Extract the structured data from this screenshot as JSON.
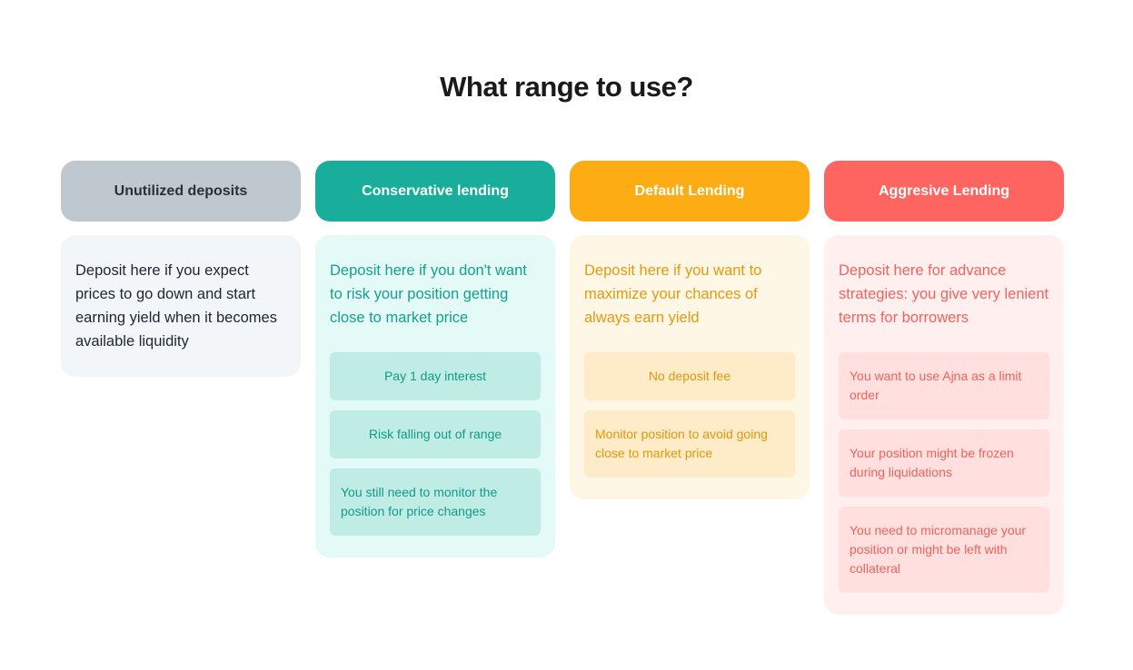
{
  "title": "What range to use?",
  "columns": [
    {
      "header": "Unutilized deposits",
      "description": "Deposit here if you expect prices to go down and start earning yield when it becomes available liquidity",
      "items": [],
      "colors": {
        "header_bg": "#bfc8cf",
        "body_bg": "#f2f6f9",
        "text": "#1d2630"
      }
    },
    {
      "header": "Conservative lending",
      "description": "Deposit here if you don't want to risk your position getting close to market price",
      "items": [
        "Pay 1 day interest",
        "Risk falling out of range",
        "You still need to monitor the position for price changes"
      ],
      "colors": {
        "header_bg": "#19ae9b",
        "body_bg": "#e4faf6",
        "text": "#14a08e"
      }
    },
    {
      "header": "Default Lending",
      "description": "Deposit here if you want to maximize your chances of always earn yield",
      "items": [
        "No deposit fee",
        "Monitor position to avoid going close to market price"
      ],
      "colors": {
        "header_bg": "#fdac13",
        "body_bg": "#fff7e5",
        "text": "#e39a10"
      }
    },
    {
      "header": "Aggresive Lending",
      "description": "Deposit here for advance strategies: you give very lenient terms for borrowers",
      "items": [
        "You want to use Ajna as a limit order",
        "Your position might be frozen during liquidations",
        "You need to micromanage your position or  might be left with collateral"
      ],
      "colors": {
        "header_bg": "#ff6560",
        "body_bg": "#fff0ef",
        "text": "#f2635c"
      }
    }
  ]
}
